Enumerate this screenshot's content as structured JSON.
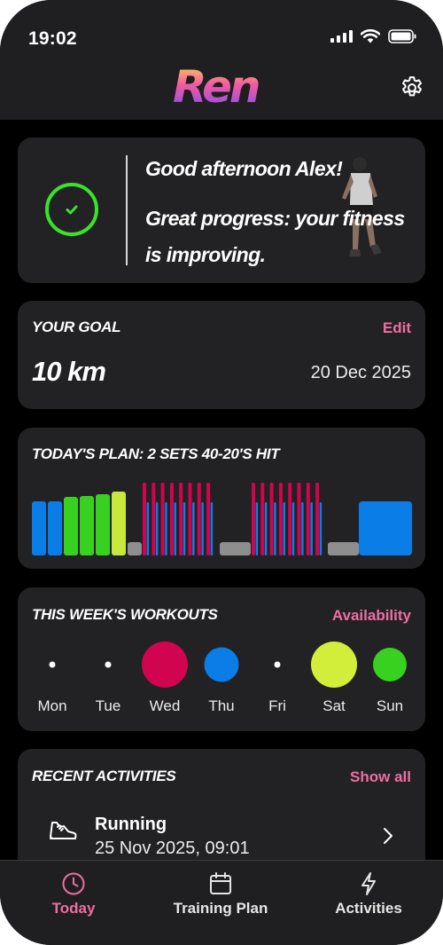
{
  "status": {
    "time": "19:02"
  },
  "app": {
    "logo_text": "Ren"
  },
  "greeting": {
    "line1": "Good afternoon Alex!",
    "line2": "Great progress: your fitness is improving."
  },
  "goal": {
    "title": "YOUR GOAL",
    "edit_label": "Edit",
    "distance": "10 km",
    "date": "20 Dec 2025"
  },
  "plan": {
    "title": "TODAY'S PLAN: 2 SETS 40-20'S HIT",
    "intensity_colors": {
      "z2": "#0a7de6",
      "z3": "#39d11f",
      "z4": "#c9e83b",
      "rest": "#8e8e8e",
      "hit": "#d0044f"
    }
  },
  "week": {
    "title": "THIS WEEK'S WORKOUTS",
    "availability_label": "Availability",
    "days": [
      {
        "label": "Mon",
        "type": "none"
      },
      {
        "label": "Tue",
        "type": "none"
      },
      {
        "label": "Wed",
        "type": "hit",
        "color": "#d0044f"
      },
      {
        "label": "Thu",
        "type": "easy",
        "color": "#0a7de6"
      },
      {
        "label": "Fri",
        "type": "none"
      },
      {
        "label": "Sat",
        "type": "long",
        "color": "#d2ee3a"
      },
      {
        "label": "Sun",
        "type": "steady",
        "color": "#39d11f"
      }
    ]
  },
  "recent": {
    "title": "RECENT ACTIVITIES",
    "show_all_label": "Show all",
    "items": [
      {
        "name": "Running",
        "time": "25 Nov 2025, 09:01",
        "icon": "running-shoe-icon"
      }
    ]
  },
  "tabs": [
    {
      "label": "Today",
      "icon": "clock-icon",
      "active": true
    },
    {
      "label": "Training Plan",
      "icon": "calendar-icon",
      "active": false
    },
    {
      "label": "Activities",
      "icon": "lightning-icon",
      "active": false
    }
  ]
}
